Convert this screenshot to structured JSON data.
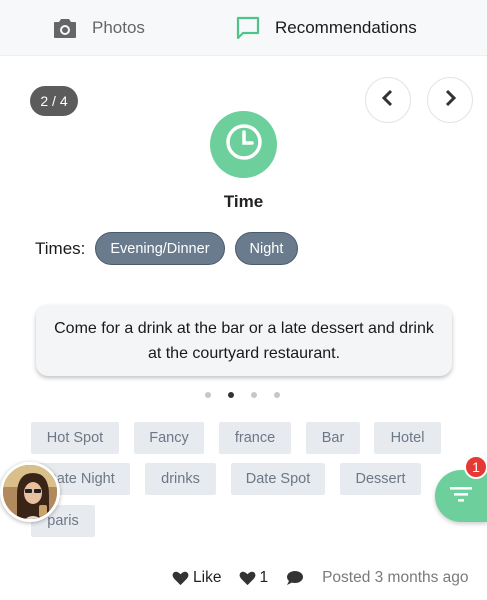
{
  "tabs": [
    {
      "label": "Photos",
      "icon": "camera-icon"
    },
    {
      "label": "Recommendations",
      "icon": "chat-bubble-icon"
    }
  ],
  "counter": "2 / 4",
  "category": {
    "title": "Time",
    "icon": "clock-icon",
    "color": "#6dcf9b"
  },
  "times": {
    "label": "Times:",
    "chips": [
      "Evening/Dinner",
      "Night"
    ]
  },
  "description": "Come for a drink at the bar or a late dessert and drink at the courtyard restaurant.",
  "carousel": {
    "total": 4,
    "active_index": 1
  },
  "tags": [
    "Hot Spot",
    "Fancy",
    "france",
    "Bar",
    "Hotel",
    "Date Night",
    "drinks",
    "Date Spot",
    "Dessert",
    "paris"
  ],
  "fab": {
    "icon": "filter-icon",
    "badge": "1"
  },
  "footer": {
    "like_label": "Like",
    "like_count": "1",
    "posted": "Posted 3 months ago"
  },
  "colors": {
    "accent": "#6dcf9b",
    "chip": "#697b8c",
    "badge": "#e53935"
  }
}
